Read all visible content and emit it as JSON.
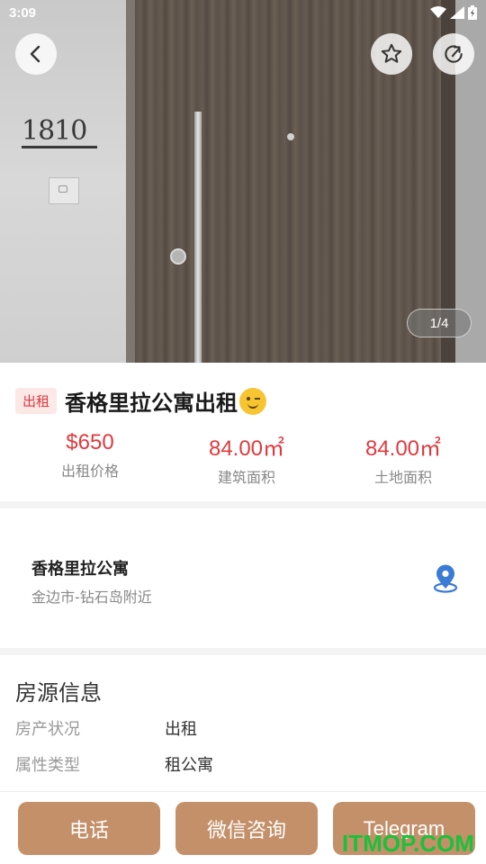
{
  "status_bar": {
    "time": "3:09"
  },
  "hero": {
    "room_number": "1810",
    "photo_counter": "1/4"
  },
  "listing": {
    "tag": "出租",
    "title": "香格里拉公寓出租",
    "stats": [
      {
        "value": "$650",
        "label": "出租价格"
      },
      {
        "value": "84.00㎡",
        "label": "建筑面积"
      },
      {
        "value": "84.00㎡",
        "label": "土地面积"
      }
    ]
  },
  "location": {
    "name": "香格里拉公寓",
    "address": "金边市-钻石岛附近"
  },
  "info": {
    "section_title": "房源信息",
    "rows": [
      {
        "key": "房产状况",
        "value": "出租"
      },
      {
        "key": "属性类型",
        "value": "租公寓"
      }
    ]
  },
  "actions": {
    "phone": "电话",
    "wechat": "微信咨询",
    "telegram": "Telegram"
  },
  "watermark": "ITMOP.COM",
  "colors": {
    "accent_red": "#e0393e",
    "action_brown": "#c4906a",
    "pin_blue": "#3a7bd5",
    "watermark_green": "#19c23a"
  },
  "icons": [
    "back-icon",
    "star-icon",
    "share-icon",
    "wifi-icon",
    "signal-icon",
    "battery-icon",
    "location-pin-icon",
    "wink-emoji-icon"
  ]
}
